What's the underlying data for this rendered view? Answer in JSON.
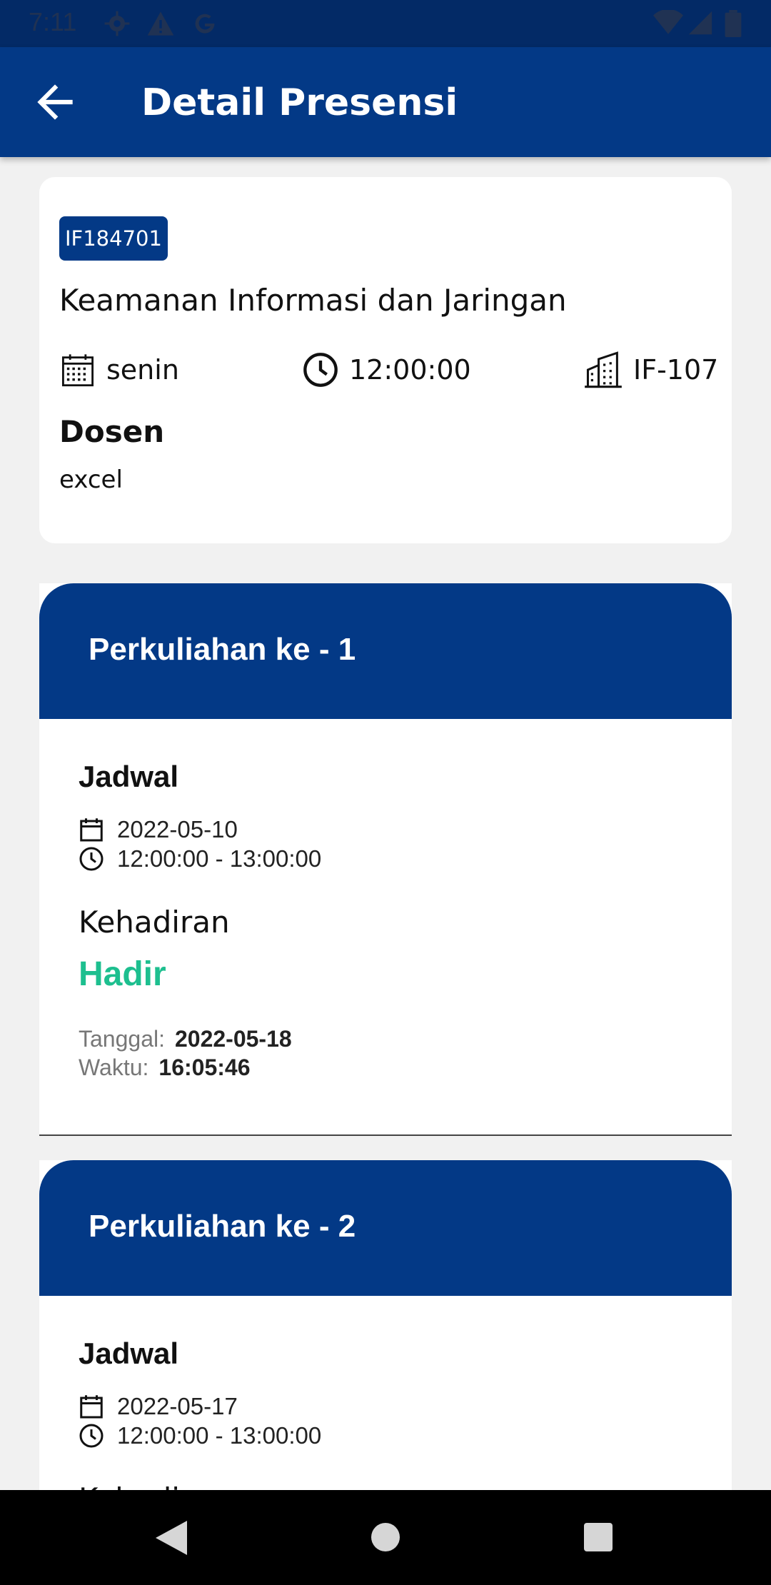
{
  "status_bar": {
    "time": "7:11"
  },
  "app_bar": {
    "title": "Detail Presensi"
  },
  "course": {
    "code": "IF184701",
    "name": "Keamanan Informasi dan Jaringan",
    "day": "senin",
    "time": "12:00:00",
    "room": "IF-107",
    "lecturer_label": "Dosen",
    "lecturer": "excel"
  },
  "sessions": [
    {
      "title": "Perkuliahan ke - 1",
      "schedule_label": "Jadwal",
      "date": "2022-05-10",
      "time_range": "12:00:00 - 13:00:00",
      "attendance_label": "Kehadiran",
      "status": "Hadir",
      "date_label": "Tanggal:",
      "attended_date": "2022-05-18",
      "time_label": "Waktu:",
      "attended_time": "16:05:46"
    },
    {
      "title": "Perkuliahan ke - 2",
      "schedule_label": "Jadwal",
      "date": "2022-05-17",
      "time_range": "12:00:00 - 13:00:00",
      "attendance_label": "Kehadiran"
    }
  ],
  "colors": {
    "primary": "#033986",
    "present": "#1dbf8f"
  },
  "icons": [
    "back-arrow-icon",
    "calendar-icon",
    "clock-icon",
    "building-icon"
  ]
}
